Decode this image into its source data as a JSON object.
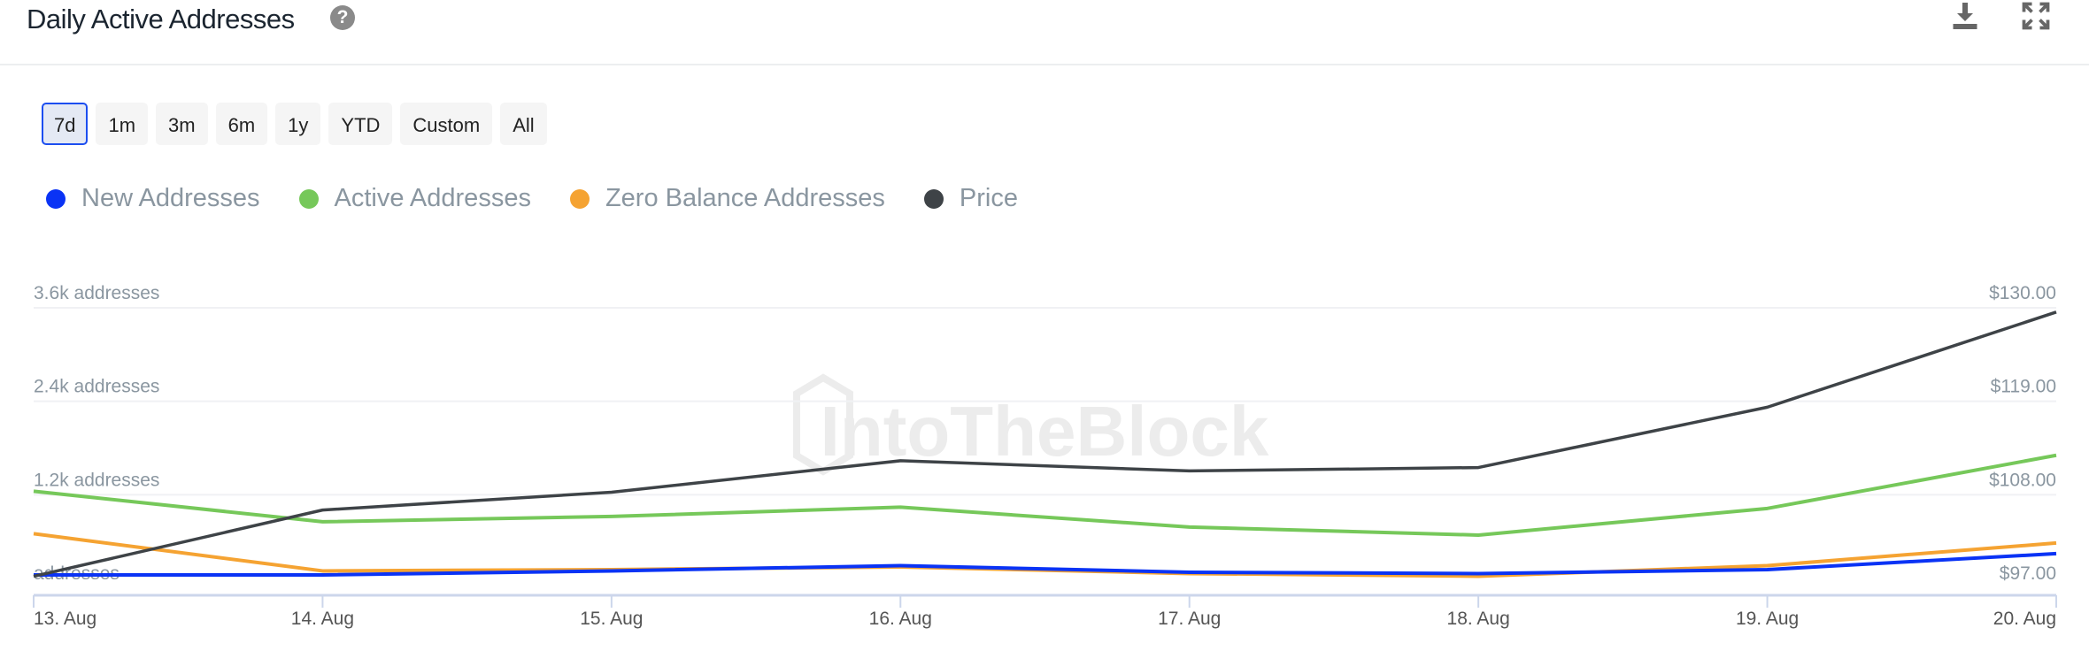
{
  "header": {
    "title": "Daily Active Addresses",
    "help_icon": "question-circle-icon",
    "download_icon": "download-icon",
    "expand_icon": "expand-icon"
  },
  "ranges": [
    {
      "label": "7d",
      "active": true
    },
    {
      "label": "1m"
    },
    {
      "label": "3m"
    },
    {
      "label": "6m"
    },
    {
      "label": "1y"
    },
    {
      "label": "YTD"
    },
    {
      "label": "Custom"
    },
    {
      "label": "All"
    }
  ],
  "watermark": "IntoTheBlock",
  "chart_data": {
    "type": "line",
    "categories": [
      "13. Aug",
      "14. Aug",
      "15. Aug",
      "16. Aug",
      "17. Aug",
      "18. Aug",
      "19. Aug",
      "20. Aug"
    ],
    "y_left": {
      "ticks": [
        "addresses",
        "1.2k addresses",
        "2.4k addresses",
        "3.6k addresses"
      ],
      "range": [
        0,
        3600
      ]
    },
    "y_right": {
      "ticks": [
        "$97.00",
        "$108.00",
        "$119.00",
        "$130.00"
      ],
      "range": [
        97,
        130
      ]
    },
    "grid": true,
    "legend_position": "top-left",
    "series": [
      {
        "name": "New Addresses",
        "color": "#0a33f5",
        "axis": "left",
        "values": [
          170,
          170,
          222,
          290,
          205,
          188,
          239,
          444
        ]
      },
      {
        "name": "Active Addresses",
        "color": "#76c85a",
        "axis": "left",
        "values": [
          1245,
          853,
          921,
          1040,
          785,
          682,
          1024,
          1706
        ]
      },
      {
        "name": "Zero Balance Addresses",
        "color": "#f5a332",
        "axis": "left",
        "values": [
          700,
          222,
          239,
          273,
          188,
          154,
          290,
          580
        ]
      },
      {
        "name": "Price",
        "color": "#3e4347",
        "axis": "right",
        "values": [
          98.4,
          106.2,
          108.3,
          112.0,
          110.8,
          111.2,
          118.3,
          129.5
        ]
      }
    ]
  }
}
